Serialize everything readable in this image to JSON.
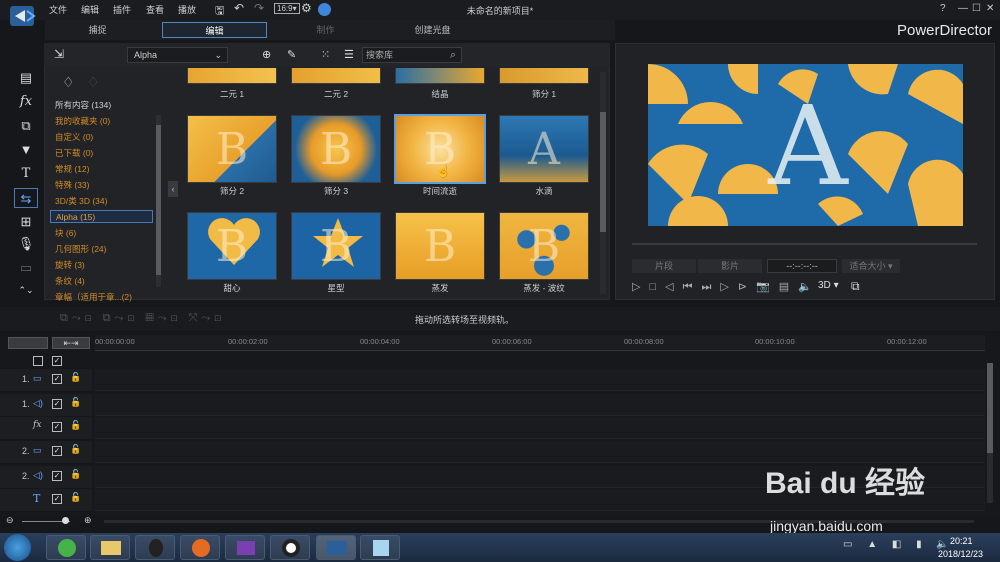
{
  "menu": [
    "文件",
    "编辑",
    "插件",
    "查看",
    "播放"
  ],
  "window_title": "未命名的新项目*",
  "brand": "PowerDirector",
  "tabs": [
    {
      "label": "捕捉"
    },
    {
      "label": "编辑"
    },
    {
      "label": "制作"
    },
    {
      "label": "创建光盘"
    }
  ],
  "library": {
    "dropdown": "Alpha",
    "search_placeholder": "搜索库",
    "categories": [
      "所有内容 (134)",
      "我的收藏夹 (0)",
      "自定义 (0)",
      "已下载 (0)",
      "常规 (12)",
      "特殊 (33)",
      "3D/类 3D (34)",
      "Alpha (15)",
      "块 (6)",
      "几何图形 (24)",
      "旋转 (3)",
      "条纹 (4)",
      "章幅（适用于章...(2)"
    ],
    "top_labels": [
      "二元 1",
      "二元 2",
      "结晶",
      "筛分 1"
    ],
    "items": [
      {
        "label": "筛分 2",
        "letter": "B"
      },
      {
        "label": "筛分 3",
        "letter": "B"
      },
      {
        "label": "时间流逝",
        "letter": "B"
      },
      {
        "label": "水滴",
        "letter": "A"
      },
      {
        "label": "甜心",
        "letter": "B"
      },
      {
        "label": "星型",
        "letter": "B"
      },
      {
        "label": "蒸发",
        "letter": "B"
      },
      {
        "label": "蒸发 - 波纹",
        "letter": "B"
      }
    ]
  },
  "preview": {
    "btn1": "片段",
    "btn2": "影片",
    "timecode": "--:--:--:--",
    "size": "适合大小",
    "mode": "3D"
  },
  "timeline": {
    "hint": "拖动所选转场至视频轨。",
    "ticks": [
      "00:00:00:00",
      "00:00:02:00",
      "00:00:04:00",
      "00:00:06:00",
      "00:00:08:00",
      "00:00:10:00",
      "00:00:12:00"
    ],
    "tracks": [
      "1.",
      "1.",
      "",
      "2.",
      "2.",
      ""
    ]
  },
  "taskbar": {
    "time": "20:21",
    "date": "2018/12/23"
  },
  "watermark": {
    "main": "Bai du 经验",
    "sub": "jingyan.baidu.com"
  }
}
